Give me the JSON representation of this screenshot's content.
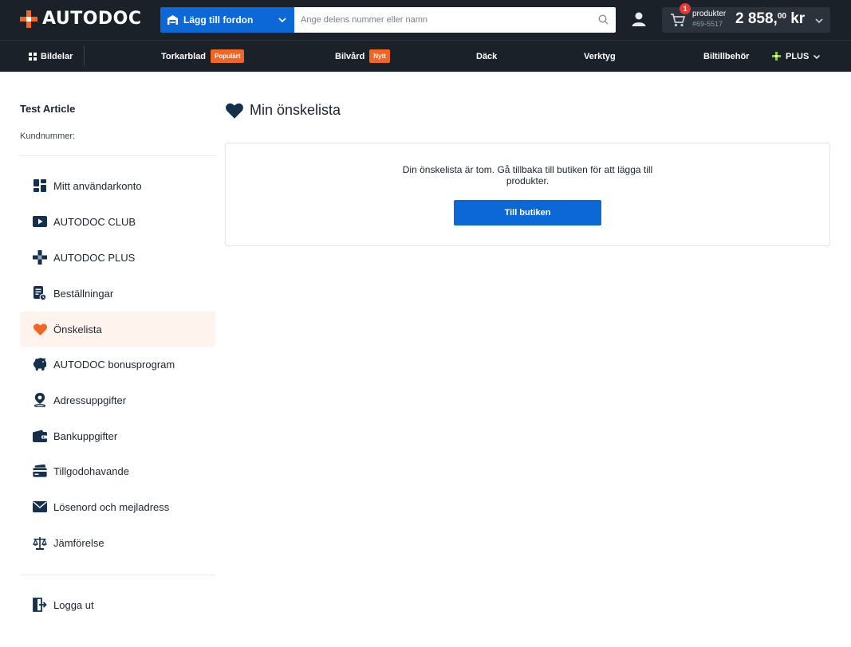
{
  "header": {
    "logo_text": "AUTODOC",
    "vehicle_button": "Lägg till fordon",
    "search_placeholder": "Ange delens nummer eller namn",
    "cart": {
      "badge": "1",
      "label": "produkter",
      "sub": "#69-5517",
      "price_main": "2 858,",
      "price_decimals": "00",
      "price_currency": " kr"
    }
  },
  "nav": {
    "items": [
      {
        "label": "Bildelar"
      },
      {
        "label": "Torkarblad",
        "tag": "Populärt"
      },
      {
        "label": "Bilvård",
        "tag": "Nytt"
      },
      {
        "label": "Däck"
      },
      {
        "label": "Verktyg"
      },
      {
        "label": "Biltillbehör"
      },
      {
        "label": "PLUS"
      }
    ]
  },
  "profile": {
    "name": "Test Article",
    "customer_number_label": "Kundnummer:"
  },
  "sidebar": {
    "items": [
      {
        "label": "Mitt användarkonto",
        "icon": "dashboard-icon"
      },
      {
        "label": "AUTODOC CLUB",
        "icon": "play-icon"
      },
      {
        "label": "AUTODOC PLUS",
        "icon": "plus-icon"
      },
      {
        "label": "Beställningar",
        "icon": "orders-icon"
      },
      {
        "label": "Önskelista",
        "icon": "heart-icon",
        "active": true
      },
      {
        "label": "AUTODOC bonusprogram",
        "icon": "piggy-bank-icon"
      },
      {
        "label": "Adressuppgifter",
        "icon": "location-pin-icon"
      },
      {
        "label": "Bankuppgifter",
        "icon": "wallet-icon"
      },
      {
        "label": "Tillgodohavande",
        "icon": "credit-card-icon"
      },
      {
        "label": "Lösenord och mejladress",
        "icon": "envelope-icon"
      },
      {
        "label": "Jämförelse",
        "icon": "scales-icon"
      }
    ],
    "logout": {
      "label": "Logga ut",
      "icon": "logout-icon"
    }
  },
  "main": {
    "title": "Min önskelista",
    "empty_message": "Din önskelista är tom. Gå tillbaka till butiken för att lägga till produkter.",
    "shop_button": "Till butiken"
  },
  "colors": {
    "header_bg": "#1b2129",
    "accent_blue": "#0b68d6",
    "accent_orange": "#f26522",
    "plus_green": "#7ed321",
    "active_item_bg": "#fff4ed",
    "icon_navy": "#15304d"
  }
}
